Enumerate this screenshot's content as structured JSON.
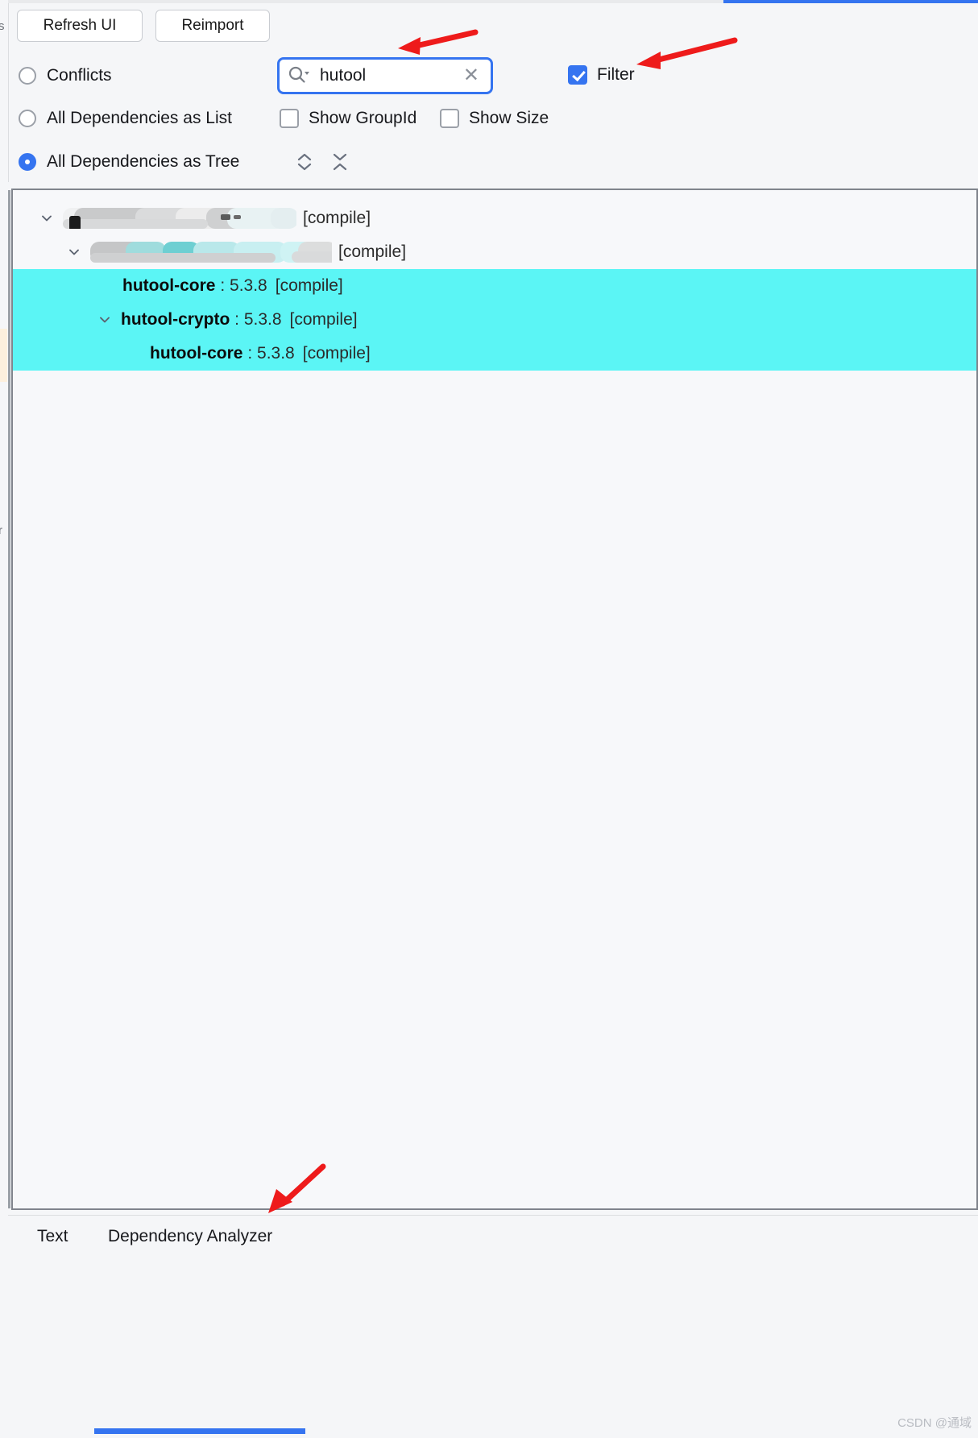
{
  "toolbar": {
    "refresh_label": "Refresh UI",
    "reimport_label": "Reimport",
    "radios": [
      {
        "label": "Conflicts",
        "checked": false
      },
      {
        "label": "All Dependencies as List",
        "checked": false
      },
      {
        "label": "All Dependencies as Tree",
        "checked": true
      }
    ],
    "checkboxes": [
      {
        "label": "Show GroupId",
        "checked": false
      },
      {
        "label": "Show Size",
        "checked": false
      },
      {
        "label": "Filter",
        "checked": true
      }
    ],
    "tree_tools": [
      {
        "name": "expand-all",
        "tooltip": "Expand All"
      },
      {
        "name": "collapse-all",
        "tooltip": "Collapse All"
      }
    ]
  },
  "search": {
    "value": "hutool",
    "placeholder": "",
    "icon": "search-icon",
    "clear_glyph": "✕"
  },
  "tree": {
    "rows": [
      {
        "indent": 30,
        "expanded": true,
        "has_chevron": true,
        "redacted": true,
        "artifact": "",
        "version": "",
        "scope": "[compile]",
        "selected": false,
        "redaction_width": 270
      },
      {
        "indent": 64,
        "expanded": true,
        "has_chevron": true,
        "redacted": true,
        "artifact": "",
        "version": "",
        "scope": "[compile]",
        "selected": false,
        "redaction_width": 300
      },
      {
        "indent": 136,
        "expanded": false,
        "has_chevron": false,
        "redacted": false,
        "artifact": "hutool-core",
        "separator": " : ",
        "version": "5.3.8",
        "scope": "[compile]",
        "selected": true
      },
      {
        "indent": 102,
        "expanded": true,
        "has_chevron": true,
        "redacted": false,
        "artifact": "hutool-crypto",
        "separator": " : ",
        "version": "5.3.8",
        "scope": "[compile]",
        "selected": true
      },
      {
        "indent": 170,
        "expanded": false,
        "has_chevron": false,
        "redacted": false,
        "artifact": "hutool-core",
        "separator": " : ",
        "version": "5.3.8",
        "scope": "[compile]",
        "selected": true
      }
    ]
  },
  "bottom": {
    "tabs": [
      {
        "label": "Text",
        "active": false
      },
      {
        "label": "Dependency Analyzer",
        "active": true
      }
    ]
  },
  "watermark": "CSDN @通域",
  "colors": {
    "accent": "#3574f0",
    "selection": "#5bf5f5",
    "annotation_arrow": "#ee1b1b",
    "panel_bg": "#f5f6f8",
    "tree_bg": "#f7f8fa",
    "border": "#80848c"
  }
}
